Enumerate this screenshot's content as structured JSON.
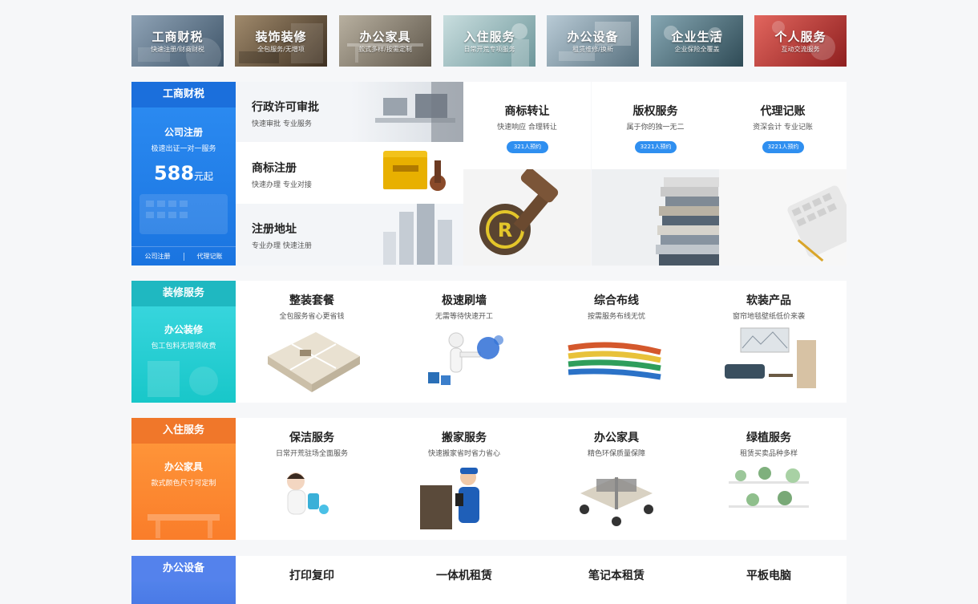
{
  "topbar": [
    {
      "title": "工商财税",
      "sub": "快速注册/财商财税",
      "color": "#5d7388"
    },
    {
      "title": "装饰装修",
      "sub": "全包服务/无增项",
      "color": "#6b5a44"
    },
    {
      "title": "办公家具",
      "sub": "款式多样/按需定制",
      "color": "#8a8272"
    },
    {
      "title": "入住服务",
      "sub": "日常开荒专项服务",
      "color": "#8fb1b4"
    },
    {
      "title": "办公设备",
      "sub": "租赁维修/换新",
      "color": "#7f98a8"
    },
    {
      "title": "企业生活",
      "sub": "企业保险全覆盖",
      "color": "#4d6d7a"
    },
    {
      "title": "个人服务",
      "sub": "互动交流服务",
      "color": "#b33a3a"
    }
  ],
  "section1": {
    "card": {
      "head": "工商财税",
      "title": "公司注册",
      "sub": "极速出证一对一服务",
      "price": "588",
      "price_unit": "元起",
      "foot_left": "公司注册",
      "foot_right": "代理记账"
    },
    "list": [
      {
        "title": "行政许可审批",
        "sub": "快速审批  专业服务"
      },
      {
        "title": "商标注册",
        "sub": "快速办理  专业对接"
      },
      {
        "title": "注册地址",
        "sub": "专业办理  快速注册"
      }
    ],
    "features": [
      {
        "title": "商标转让",
        "sub": "快速响应  合理转让",
        "btn": "321人预约"
      },
      {
        "title": "版权服务",
        "sub": "属于你的独一无二",
        "btn": "3221人预约"
      },
      {
        "title": "代理记账",
        "sub": "资深会计  专业记账",
        "btn": "3221人预约"
      }
    ]
  },
  "section2": {
    "card": {
      "head": "装修服务",
      "title": "办公装修",
      "sub": "包工包料无增项收费"
    },
    "items": [
      {
        "title": "整装套餐",
        "sub": "全包服务省心更省钱"
      },
      {
        "title": "极速刷墙",
        "sub": "无需等待快速开工"
      },
      {
        "title": "综合布线",
        "sub": "按需服务布线无忧"
      },
      {
        "title": "软装产品",
        "sub": "窗帘地毯壁纸低价来袭"
      }
    ]
  },
  "section3": {
    "card": {
      "head": "入住服务",
      "title": "办公家具",
      "sub": "款式颜色尺寸可定制"
    },
    "items": [
      {
        "title": "保洁服务",
        "sub": "日常开荒驻场全面服务"
      },
      {
        "title": "搬家服务",
        "sub": "快速搬家省时省力省心"
      },
      {
        "title": "办公家具",
        "sub": "精色环保质量保障"
      },
      {
        "title": "绿植服务",
        "sub": "租赁买卖品种多样"
      }
    ]
  },
  "section4": {
    "card": {
      "head": "办公设备"
    },
    "items": [
      {
        "title": "打印复印"
      },
      {
        "title": "一体机租赁"
      },
      {
        "title": "笔记本租赁"
      },
      {
        "title": "平板电脑"
      }
    ]
  }
}
